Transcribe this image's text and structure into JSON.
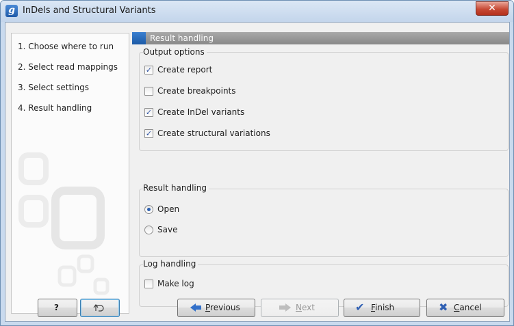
{
  "window": {
    "title": "InDels and Structural Variants",
    "icon_letter": "g",
    "close_label": "✕"
  },
  "sidebar": {
    "steps": [
      {
        "label": "1.  Choose where to run"
      },
      {
        "label": "2.  Select read mappings"
      },
      {
        "label": "3.  Select settings"
      },
      {
        "label": "4.  Result handling"
      }
    ]
  },
  "panel": {
    "header": "Result handling"
  },
  "output_options": {
    "label": "Output options",
    "items": [
      {
        "label": "Create report",
        "checked": true
      },
      {
        "label": "Create breakpoints",
        "checked": false
      },
      {
        "label": "Create InDel variants",
        "checked": true
      },
      {
        "label": "Create structural variations",
        "checked": true
      }
    ]
  },
  "result_handling": {
    "label": "Result handling",
    "options": [
      {
        "label": "Open",
        "selected": true
      },
      {
        "label": "Save",
        "selected": false
      }
    ]
  },
  "log_handling": {
    "label": "Log handling",
    "make_log": {
      "label": "Make log",
      "checked": false
    }
  },
  "buttons": {
    "help": "?",
    "reset_icon": "reset-icon",
    "previous": {
      "underlined": "P",
      "rest": "revious"
    },
    "next": {
      "underlined": "N",
      "rest": "ext"
    },
    "finish": {
      "underlined": "F",
      "rest": "inish"
    },
    "cancel": {
      "underlined": "C",
      "rest": "ancel"
    }
  },
  "colors": {
    "accent": "#2b64b8",
    "header_gray": "#999999",
    "close_red": "#c74a35"
  }
}
